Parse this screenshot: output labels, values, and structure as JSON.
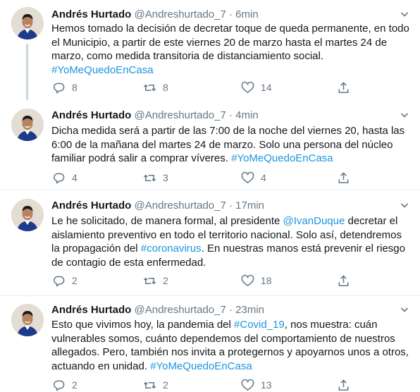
{
  "tweets": [
    {
      "name": "Andrés Hurtado",
      "handle": "@Andreshurtado_7",
      "dot": "·",
      "time": "6min",
      "text_parts": [
        {
          "t": "Hemos tomado la decisión de decretar toque de queda permanente, en todo el Municipio, a partir de este viernes 20 de marzo hasta el martes 24 de marzo, como medida transitoria de distanciamiento social. "
        },
        {
          "t": "#YoMeQuedoEnCasa",
          "link": true
        }
      ],
      "replies": "8",
      "retweets": "8",
      "likes": "14"
    },
    {
      "name": "Andrés Hurtado",
      "handle": "@Andreshurtado_7",
      "dot": "·",
      "time": "4min",
      "text_parts": [
        {
          "t": "Dicha medida será a partir de las 7:00 de la noche del viernes 20, hasta las 6:00 de la mañana del martes 24 de marzo. Solo una persona del núcleo familiar podrá salir a comprar víveres. "
        },
        {
          "t": "#YoMeQuedoEnCasa",
          "link": true
        }
      ],
      "replies": "4",
      "retweets": "3",
      "likes": "4"
    },
    {
      "name": "Andrés Hurtado",
      "handle": "@Andreshurtado_7",
      "dot": "·",
      "time": "17min",
      "text_parts": [
        {
          "t": "Le he solicitado, de manera formal, al presidente "
        },
        {
          "t": "@IvanDuque",
          "link": true
        },
        {
          "t": " decretar el aislamiento preventivo en todo el territorio nacional. Solo así, detendremos la propagación del "
        },
        {
          "t": "#coronavirus",
          "link": true
        },
        {
          "t": ". En nuestras manos está prevenir el riesgo de contagio de esta enfermedad."
        }
      ],
      "replies": "2",
      "retweets": "2",
      "likes": "18"
    },
    {
      "name": "Andrés Hurtado",
      "handle": "@Andreshurtado_7",
      "dot": "·",
      "time": "23min",
      "text_parts": [
        {
          "t": "Esto que vivimos hoy, la pandemia del "
        },
        {
          "t": "#Covid_19",
          "link": true
        },
        {
          "t": ", nos muestra: cuán vulnerables somos, cuánto dependemos del comportamiento de nuestros allegados. Pero, también nos invita a protegernos y apoyarnos unos a otros, actuando en unidad. "
        },
        {
          "t": "#YoMeQuedoEnCasa",
          "link": true
        }
      ],
      "replies": "2",
      "retweets": "2",
      "likes": "13"
    }
  ],
  "colors": {
    "text": "#14171a",
    "muted": "#657786",
    "link": "#1b95e0",
    "divider": "#e6ecf0"
  }
}
